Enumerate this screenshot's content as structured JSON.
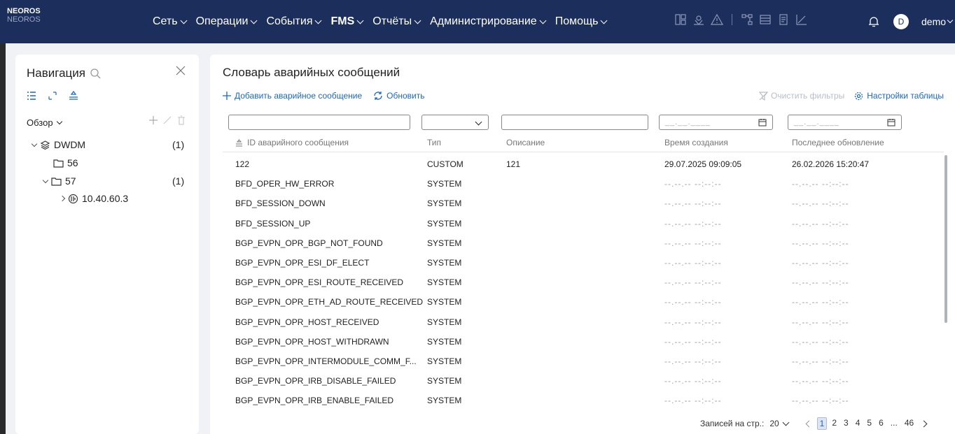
{
  "brand": {
    "name": "NEOROS",
    "sub": "NEOROS"
  },
  "menu": [
    {
      "label": "Сеть",
      "bold": false
    },
    {
      "label": "Операции",
      "bold": false
    },
    {
      "label": "События",
      "bold": false
    },
    {
      "label": "FMS",
      "bold": true
    },
    {
      "label": "Отчёты",
      "bold": false
    },
    {
      "label": "Администрирование",
      "bold": false
    },
    {
      "label": "Помощь",
      "bold": false
    }
  ],
  "user": {
    "initial": "D",
    "name": "demo"
  },
  "nav": {
    "title": "Навигация",
    "overview": "Обзор",
    "tree": [
      {
        "label": "DWDM",
        "count": "(1)"
      },
      {
        "label": "56",
        "count": ""
      },
      {
        "label": "57",
        "count": "(1)"
      },
      {
        "label": "10.40.60.3",
        "count": ""
      }
    ]
  },
  "main": {
    "title": "Словарь аварийных сообщений",
    "add_label": "Добавить аварийное сообщение",
    "refresh_label": "Обновить",
    "clear_label": "Очистить фильтры",
    "settings_label": "Настройки таблицы",
    "date_placeholder": "__.__.____",
    "columns": [
      "ID аварийного сообщения",
      "Тип",
      "Описание",
      "Время создания",
      "Последнее обновление"
    ],
    "rows": [
      {
        "id": "122",
        "type": "CUSTOM",
        "desc": "121",
        "created": "29.07.2025 09:09:05",
        "updated": "26.02.2026 15:20:47"
      },
      {
        "id": "BFD_OPER_HW_ERROR",
        "type": "SYSTEM",
        "desc": "",
        "created": "--.--.-- --:--:--",
        "updated": "--.--.-- --:--:--"
      },
      {
        "id": "BFD_SESSION_DOWN",
        "type": "SYSTEM",
        "desc": "",
        "created": "--.--.-- --:--:--",
        "updated": "--.--.-- --:--:--"
      },
      {
        "id": "BFD_SESSION_UP",
        "type": "SYSTEM",
        "desc": "",
        "created": "--.--.-- --:--:--",
        "updated": "--.--.-- --:--:--"
      },
      {
        "id": "BGP_EVPN_OPR_BGP_NOT_FOUND",
        "type": "SYSTEM",
        "desc": "",
        "created": "--.--.-- --:--:--",
        "updated": "--.--.-- --:--:--"
      },
      {
        "id": "BGP_EVPN_OPR_ESI_DF_ELECT",
        "type": "SYSTEM",
        "desc": "",
        "created": "--.--.-- --:--:--",
        "updated": "--.--.-- --:--:--"
      },
      {
        "id": "BGP_EVPN_OPR_ESI_ROUTE_RECEIVED",
        "type": "SYSTEM",
        "desc": "",
        "created": "--.--.-- --:--:--",
        "updated": "--.--.-- --:--:--"
      },
      {
        "id": "BGP_EVPN_OPR_ETH_AD_ROUTE_RECEIVED",
        "type": "SYSTEM",
        "desc": "",
        "created": "--.--.-- --:--:--",
        "updated": "--.--.-- --:--:--"
      },
      {
        "id": "BGP_EVPN_OPR_HOST_RECEIVED",
        "type": "SYSTEM",
        "desc": "",
        "created": "--.--.-- --:--:--",
        "updated": "--.--.-- --:--:--"
      },
      {
        "id": "BGP_EVPN_OPR_HOST_WITHDRAWN",
        "type": "SYSTEM",
        "desc": "",
        "created": "--.--.-- --:--:--",
        "updated": "--.--.-- --:--:--"
      },
      {
        "id": "BGP_EVPN_OPR_INTERMODULE_COMM_F...",
        "type": "SYSTEM",
        "desc": "",
        "created": "--.--.-- --:--:--",
        "updated": "--.--.-- --:--:--"
      },
      {
        "id": "BGP_EVPN_OPR_IRB_DISABLE_FAILED",
        "type": "SYSTEM",
        "desc": "",
        "created": "--.--.-- --:--:--",
        "updated": "--.--.-- --:--:--"
      },
      {
        "id": "BGP_EVPN_OPR_IRB_ENABLE_FAILED",
        "type": "SYSTEM",
        "desc": "",
        "created": "--.--.-- --:--:--",
        "updated": "--.--.-- --:--:--"
      }
    ],
    "pager": {
      "per_page_label": "Записей на стр.:",
      "per_page": "20",
      "pages": [
        "1",
        "2",
        "3",
        "4",
        "5",
        "6",
        "...",
        "46"
      ],
      "current": "1"
    }
  },
  "colors": {
    "topbar": "#1c2e5c",
    "accent": "#1a66c9"
  }
}
